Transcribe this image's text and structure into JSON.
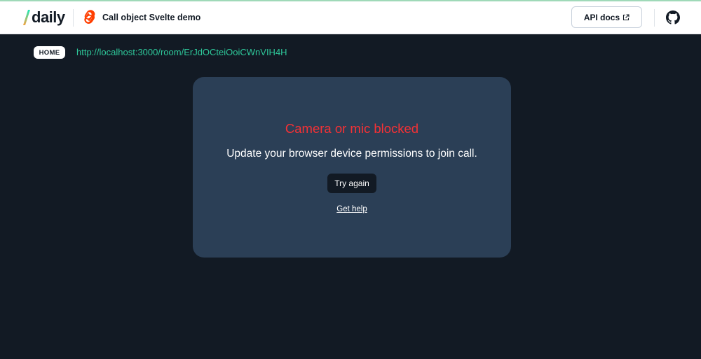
{
  "header": {
    "logo_text": "daily",
    "app_title": "Call object Svelte demo",
    "api_docs_label": "API docs",
    "icons": {
      "logo_slash": "daily-slash-icon",
      "svelte": "svelte-logo-icon",
      "external_link": "external-link-icon",
      "github": "github-icon"
    }
  },
  "nav": {
    "home_label": "HOME",
    "room_url": "http://localhost:3000/room/ErJdOCteiOoiCWnVIH4H"
  },
  "card": {
    "title": "Camera or mic blocked",
    "subtitle": "Update your browser device permissions to join call.",
    "try_again_label": "Try again",
    "help_label": "Get help"
  },
  "colors": {
    "background": "#121a24",
    "card": "#2b3f56",
    "error": "#f63135",
    "url": "#2ec89a"
  }
}
